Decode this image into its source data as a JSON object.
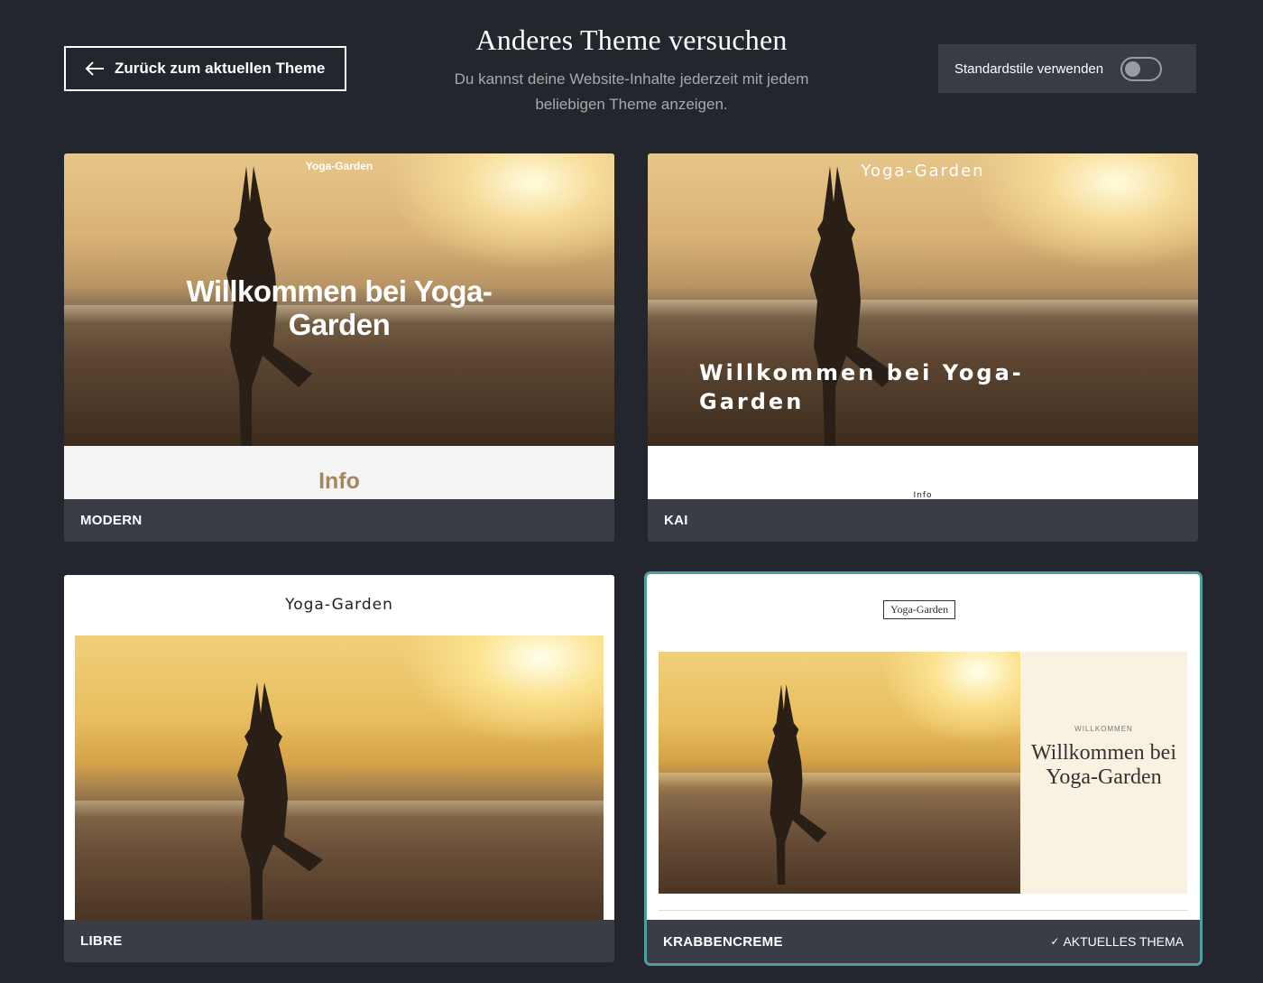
{
  "header": {
    "back_label": "Zurück zum aktuellen Theme",
    "title": "Anderes Theme versuchen",
    "subtitle": "Du kannst deine Website-Inhalte jederzeit mit jedem beliebigen Theme anzeigen.",
    "toggle_label": "Standardstile verwenden",
    "toggle_on": false
  },
  "themes": [
    {
      "name": "MODERN",
      "site_title": "Yoga-Garden",
      "hero": "Willkommen bei Yoga-Garden",
      "section": "Info"
    },
    {
      "name": "KAI",
      "site_title": "Yoga-Garden",
      "hero": "Willkommen bei Yoga-Garden",
      "section": "Info"
    },
    {
      "name": "LIBRE",
      "site_title": "Yoga-Garden"
    },
    {
      "name": "KRABBENCREME",
      "site_title": "Yoga-Garden",
      "eyebrow": "WILLKOMMEN",
      "hero": "Willkommen bei Yoga-Garden",
      "current_label": "AKTUELLES THEMA",
      "is_current": true
    }
  ],
  "colors": {
    "background": "#24262d",
    "card_footer": "#3a3d46",
    "selected_border": "#4e9f9f",
    "modern_info": "#a48660",
    "krabben_panel": "#f9f1e1"
  },
  "icons": {
    "back": "arrow-left-icon",
    "check": "check-icon"
  }
}
